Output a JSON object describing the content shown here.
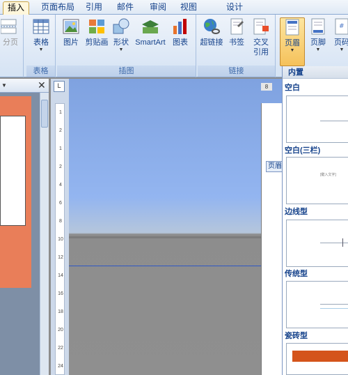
{
  "tabs": [
    {
      "label": "插入",
      "active": true
    },
    {
      "label": "页面布局",
      "active": false
    },
    {
      "label": "引用",
      "active": false
    },
    {
      "label": "邮件",
      "active": false
    },
    {
      "label": "审阅",
      "active": false
    },
    {
      "label": "视图",
      "active": false
    },
    {
      "label": "设计",
      "active": false
    }
  ],
  "ribbon": {
    "pages_group": {
      "page_break": "分页"
    },
    "tables_group": {
      "table": "表格",
      "label": "表格"
    },
    "illustrations_group": {
      "picture": "图片",
      "clipart": "剪贴画",
      "shapes": "形状",
      "smartart": "SmartArt",
      "chart": "图表",
      "label": "插图"
    },
    "links_group": {
      "hyperlink": "超链接",
      "bookmark": "书签",
      "crossref_line1": "交叉",
      "crossref_line2": "引用",
      "label": "链接"
    },
    "header_footer_group": {
      "header": "页眉",
      "footer": "页脚",
      "page_number": "页码"
    }
  },
  "document": {
    "page_number_marker": "8",
    "header_tag": "页眉",
    "ruler_ticks": [
      "1",
      "2",
      "1",
      "2",
      "4",
      "6",
      "8",
      "10",
      "12",
      "14",
      "16",
      "18",
      "20",
      "22",
      "24"
    ]
  },
  "gallery": {
    "header": "内置",
    "items": [
      {
        "title": "空白",
        "preview_text": ""
      },
      {
        "title": "空白(三栏)",
        "preview_text": "[键入文字]"
      },
      {
        "title": "边线型",
        "preview_text": ""
      },
      {
        "title": "传统型",
        "preview_text": ""
      },
      {
        "title": "瓷砖型",
        "preview_text": ""
      }
    ]
  },
  "colors": {
    "accent_orange": "#d4541b",
    "thumb_orange": "#e97e59",
    "ribbon_blue": "#15428b",
    "doc_blue": "#93b5f0"
  }
}
